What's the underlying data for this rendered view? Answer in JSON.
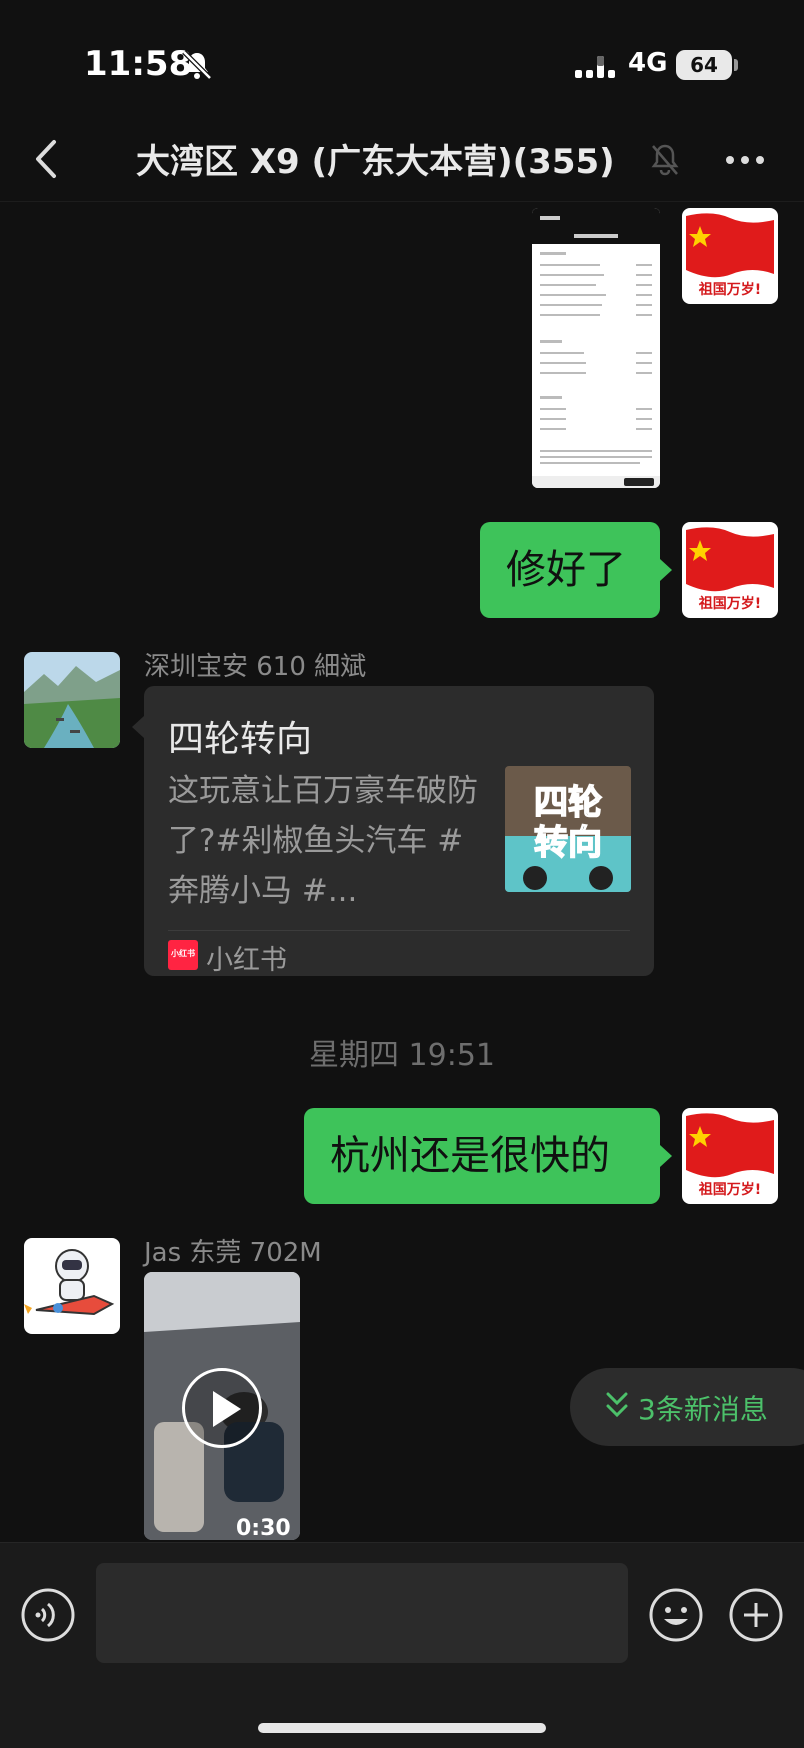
{
  "status_bar": {
    "time": "11:58",
    "network": "4G",
    "battery": "64"
  },
  "nav": {
    "title": "大湾区 X9 (广东大本营)(355)"
  },
  "messages": {
    "flag_caption": "祖国万岁!",
    "outgoing_1": "修好了",
    "card_sender": "深圳宝安 610 細斌",
    "card": {
      "title": "四轮转向",
      "description": "这玩意让百万豪车破防了?#剁椒鱼头汽车  #奔腾小马  #...",
      "thumb_text_1": "四轮",
      "thumb_text_2": "转向",
      "source_icon_text": "小红书",
      "source": "小红书"
    },
    "time_divider": "星期四 19:51",
    "outgoing_2": "杭州还是很快的",
    "video_sender": "Jas 东莞 702M",
    "video_duration": "0:30"
  },
  "new_messages": {
    "label": "3条新消息"
  },
  "input": {
    "placeholder": ""
  },
  "colors": {
    "bubble_green": "#3ec35a",
    "accent_green": "#4cc16a",
    "background": "#111111"
  },
  "icons": [
    "bell-off-icon",
    "signal-icon",
    "back-chevron-icon",
    "mute-bell-icon",
    "more-dots-icon",
    "voice-icon",
    "emoji-icon",
    "plus-icon",
    "double-chevron-down-icon",
    "play-icon"
  ]
}
